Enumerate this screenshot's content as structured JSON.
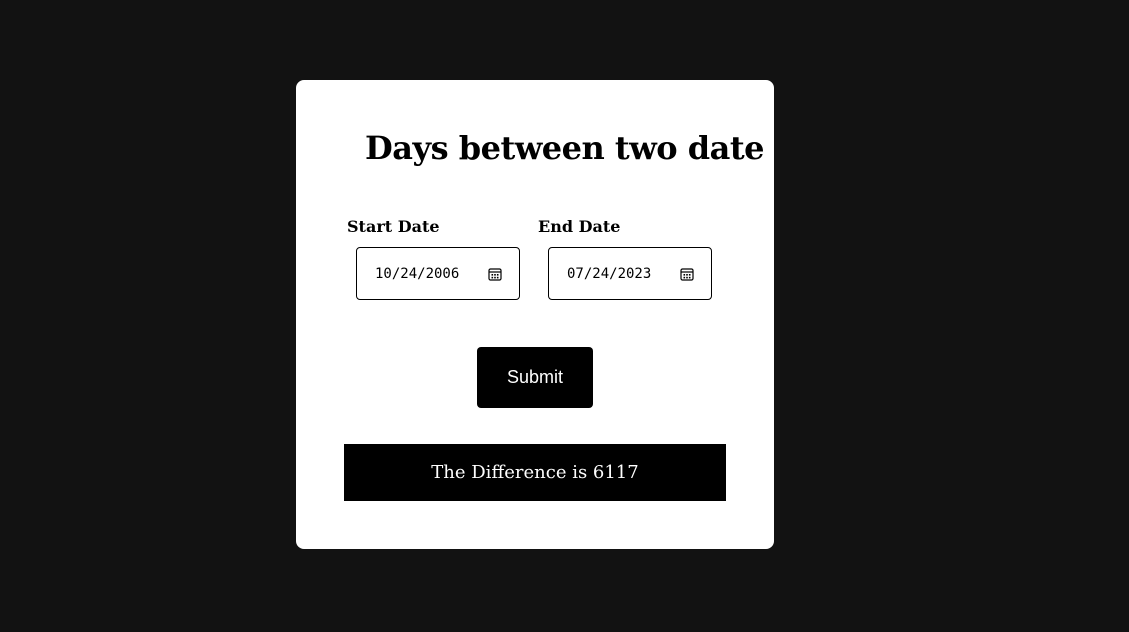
{
  "page": {
    "title": "Days between two date"
  },
  "form": {
    "start_label": "Start Date",
    "start_value": "10/24/2006",
    "end_label": "End Date",
    "end_value": "07/24/2023",
    "submit_label": "Submit"
  },
  "result": {
    "text": "The Difference is 6117"
  },
  "icons": {
    "start_picker": "calendar-icon",
    "end_picker": "calendar-icon"
  },
  "colors": {
    "background": "#121212",
    "card": "#ffffff",
    "button": "#000000",
    "button_text": "#ffffff"
  }
}
